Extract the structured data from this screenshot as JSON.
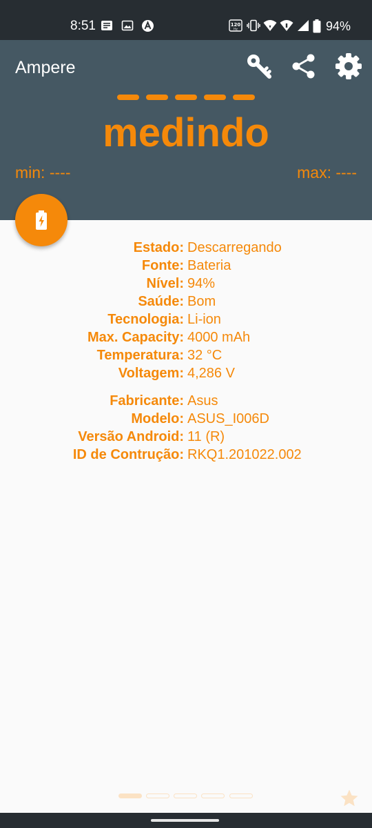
{
  "status_bar": {
    "time": "8:51",
    "battery_percent": "94%",
    "icons": [
      "notification-icon",
      "image-icon",
      "a-badge-icon",
      "120hz-icon",
      "vibrate-icon",
      "wifi-icon",
      "signal-icon",
      "battery-icon"
    ]
  },
  "toolbar": {
    "title": "Ampere",
    "actions": [
      "key-icon",
      "share-icon",
      "gear-icon"
    ]
  },
  "reading": {
    "value_placeholder": "-----",
    "status": "medindo",
    "min_label": "min: ----",
    "max_label": "max: ----"
  },
  "fab": {
    "icon": "battery-charging-icon"
  },
  "battery_info": [
    {
      "label": "Estado:",
      "value": "Descarregando"
    },
    {
      "label": "Fonte:",
      "value": "Bateria"
    },
    {
      "label": "Nível:",
      "value": "94%"
    },
    {
      "label": "Saúde:",
      "value": "Bom"
    },
    {
      "label": "Tecnologia:",
      "value": "Li-ion"
    },
    {
      "label": "Max. Capacity:",
      "value": "4000 mAh"
    },
    {
      "label": "Temperatura:",
      "value": "32 °C"
    },
    {
      "label": "Voltagem:",
      "value": "4,286 V"
    }
  ],
  "device_info": [
    {
      "label": "Fabricante:",
      "value": "Asus"
    },
    {
      "label": "Modelo:",
      "value": "ASUS_I006D"
    },
    {
      "label": "Versão Android:",
      "value": "11 (R)"
    },
    {
      "label": "ID de Contrução:",
      "value": "RKQ1.201022.002"
    }
  ],
  "pager": {
    "pages": 5,
    "active_index": 0
  },
  "colors": {
    "accent": "#f5890a",
    "header": "#455863",
    "status_bar": "#272d32",
    "background": "#fafafa"
  }
}
